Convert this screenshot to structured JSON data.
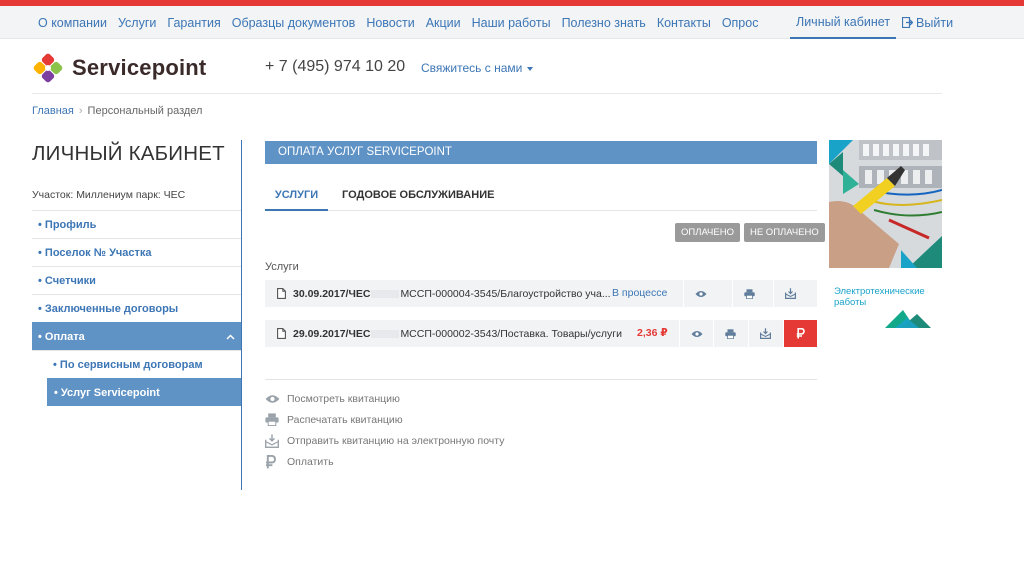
{
  "top_nav": {
    "links": [
      "О компании",
      "Услуги",
      "Гарантия",
      "Образцы документов",
      "Новости",
      "Акции",
      "Наши работы",
      "Полезно знать",
      "Контакты",
      "Опрос"
    ],
    "cabinet": "Личный кабинет",
    "logout": "Выйти"
  },
  "header": {
    "logo_text": "Servicepoint",
    "phone": "+ 7 (495) 974 10 20",
    "contact": "Свяжитесь с нами"
  },
  "breadcrumb": {
    "home": "Главная",
    "current": "Персональный раздел"
  },
  "sidebar": {
    "title": "ЛИЧНЫЙ КАБИНЕТ",
    "plot": "Участок: Миллениум парк: ЧЕС",
    "menu": [
      "• Профиль",
      "• Поселок № Участка",
      "• Счетчики",
      "• Заключенные договоры",
      "• Оплата"
    ],
    "submenu": [
      "• По сервисным договорам",
      "• Услуг Servicepoint"
    ]
  },
  "main": {
    "section_title": "ОПЛАТА УСЛУГ SERVICEPOINT",
    "tabs": [
      "УСЛУГИ",
      "ГОДОВОЕ ОБСЛУЖИВАНИЕ"
    ],
    "filters": [
      "ОПЛАЧЕНО",
      "НЕ ОПЛАЧЕНО"
    ],
    "list_label": "Услуги",
    "rows": [
      {
        "date": "30.09.2017/ЧЕС",
        "text": "МССП-000004-3545/Благоустройство уча...",
        "status": "В процессе"
      },
      {
        "date": "29.09.2017/ЧЕС",
        "text": "МССП-000002-3543/Поставка. Товары/услуги",
        "amount": "2,36 ₽"
      }
    ],
    "legend": [
      "Посмотреть квитанцию",
      "Распечатать квитанцию",
      "Отправить квитанцию на электронную почту",
      "Оплатить"
    ]
  },
  "ad": {
    "caption_line1": "Электротехнические",
    "caption_line2": "работы"
  },
  "colors": {
    "accent_blue": "#3d76b5",
    "panel_blue": "#5f92c5",
    "red": "#e53935",
    "teal": "#1aa3c9"
  }
}
